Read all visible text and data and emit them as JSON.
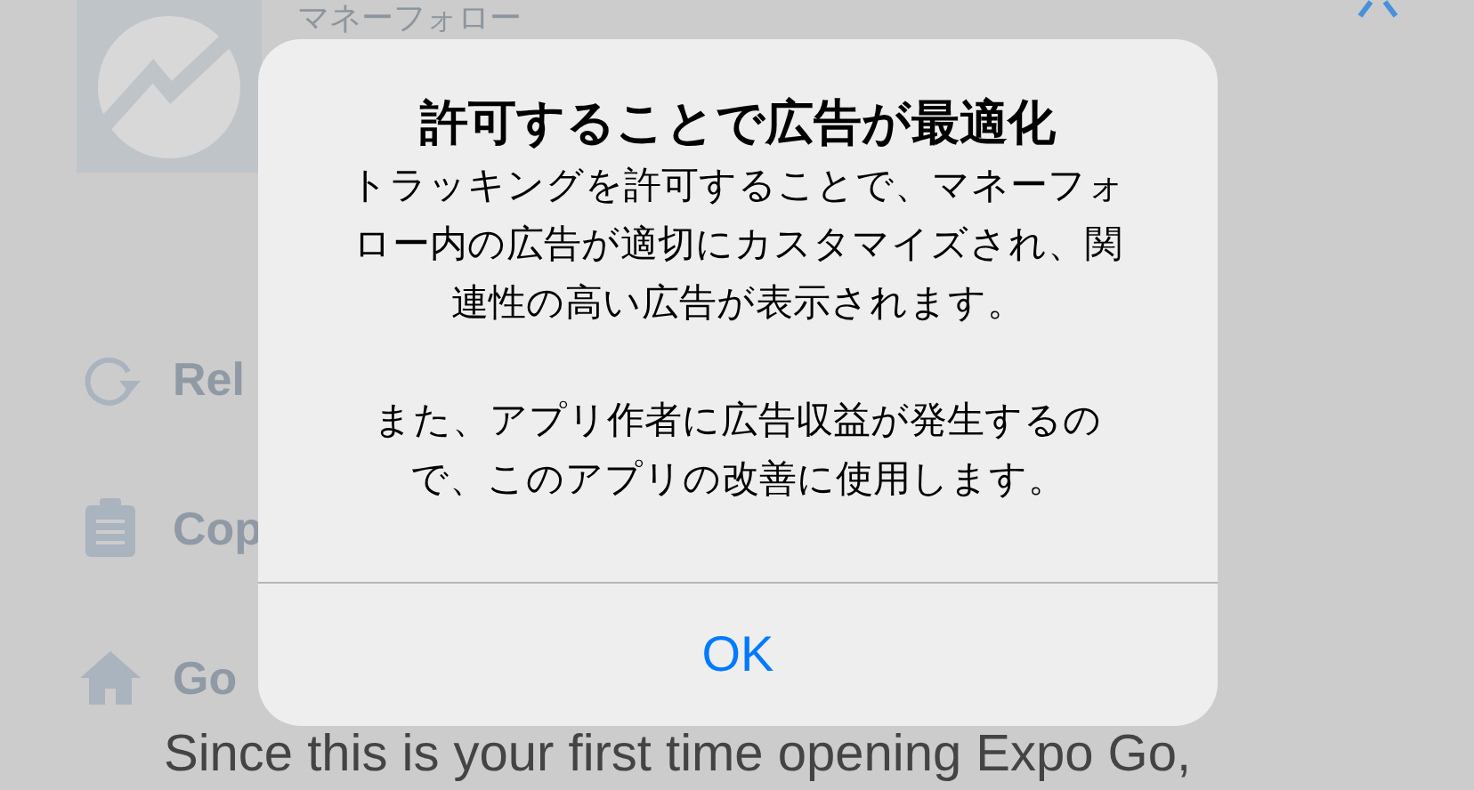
{
  "app": {
    "title": "マネーフォロー"
  },
  "menu_items": [
    {
      "kind": "reload",
      "label": "Rel"
    },
    {
      "kind": "copy",
      "label": "Cop"
    },
    {
      "kind": "home",
      "label": "Go"
    }
  ],
  "intro_text": "Since this is your first time opening Expo Go,",
  "dialog": {
    "title": "許可することで広告が最適化",
    "paragraphs": [
      "トラッキングを許可することで、マネーフォロー内の広告が適切にカスタマイズされ、関連性の高い広告が表示されます。",
      "また、アプリ作者に広告収益が発生するので、このアプリの改善に使用します。"
    ],
    "button": "OK"
  }
}
